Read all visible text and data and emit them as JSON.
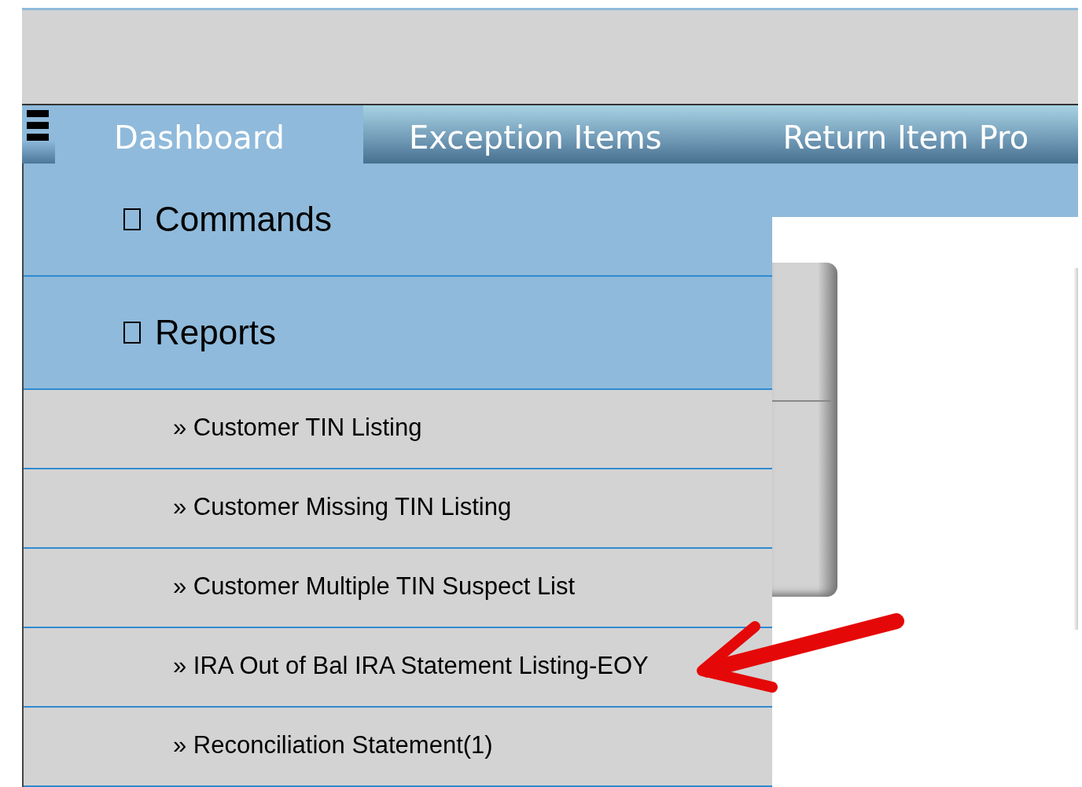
{
  "tabs": [
    {
      "label": "Dashboard",
      "selected": true
    },
    {
      "label": "Exception Items",
      "selected": false
    },
    {
      "label": "Return Item Pro",
      "selected": false
    }
  ],
  "sections": [
    {
      "title": "Commands"
    },
    {
      "title": "Reports",
      "items": [
        {
          "label": "» Customer TIN Listing"
        },
        {
          "label": "» Customer Missing TIN Listing"
        },
        {
          "label": "» Customer Multiple TIN Suspect List"
        },
        {
          "label": "» IRA Out of Bal IRA Statement Listing-EOY"
        },
        {
          "label": "» Reconciliation Statement(1)"
        }
      ]
    }
  ]
}
